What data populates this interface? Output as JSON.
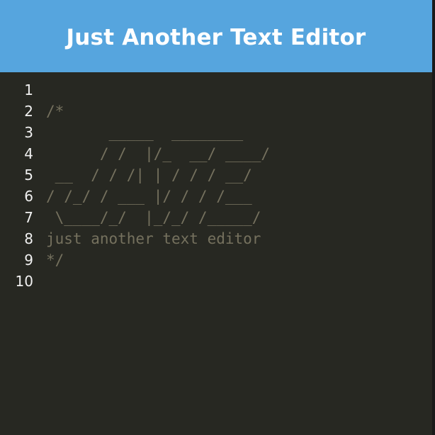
{
  "header": {
    "title": "Just Another Text Editor"
  },
  "editor": {
    "lines": [
      {
        "number": "1",
        "text": ""
      },
      {
        "number": "2",
        "text": "/*"
      },
      {
        "number": "3",
        "text": "       _____  ________"
      },
      {
        "number": "4",
        "text": "      / /  |/_  __/ ____/"
      },
      {
        "number": "5",
        "text": " __  / / /| | / / / __/"
      },
      {
        "number": "6",
        "text": "/ /_/ / ___ |/ / / /___"
      },
      {
        "number": "7",
        "text": " \\____/_/  |_/_/ /_____/"
      },
      {
        "number": "8",
        "text": "just another text editor"
      },
      {
        "number": "9",
        "text": "*/"
      },
      {
        "number": "10",
        "text": ""
      }
    ]
  },
  "colors": {
    "header_bg": "#56a5de",
    "editor_bg": "#272822",
    "comment": "#75715e",
    "gutter_text": "#f0f0f0"
  }
}
